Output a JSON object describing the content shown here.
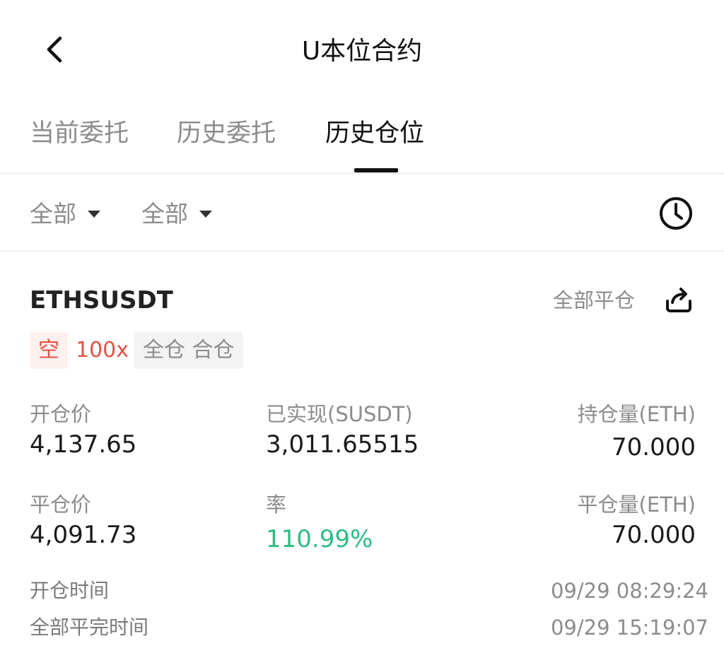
{
  "header": {
    "title": "U本位合约",
    "back_icon": "chevron-left-icon"
  },
  "tabs": [
    {
      "label": "当前委托",
      "active": false
    },
    {
      "label": "历史委托",
      "active": false
    },
    {
      "label": "历史仓位",
      "active": true
    }
  ],
  "filters": [
    {
      "label": "全部"
    },
    {
      "label": "全部"
    }
  ],
  "history_icon": "clock-icon",
  "position": {
    "symbol": "ETHSUSDT",
    "close_all_label": "全部平仓",
    "share_icon": "share-icon",
    "side": "空",
    "leverage": "100x",
    "mode": "全仓 合仓",
    "fields": {
      "open_price_label": "开仓价",
      "open_price": "4,137.65",
      "realized_pnl_label": "已实现(SUSDT)",
      "realized_pnl": "3,011.65515",
      "position_size_label": "持仓量(ETH)",
      "position_size": "70.000",
      "close_price_label": "平仓价",
      "close_price": "4,091.73",
      "roi_label": "率",
      "roi": "110.99%",
      "closed_size_label": "平仓量(ETH)",
      "closed_size": "70.000"
    },
    "open_time_label": "开仓时间",
    "open_time": "09/29 08:29:24",
    "close_time_label": "全部平完时间",
    "close_time": "09/29 15:19:07"
  },
  "colors": {
    "short": "#e35245",
    "profit": "#2ebd85",
    "muted": "#8c8c8c"
  }
}
